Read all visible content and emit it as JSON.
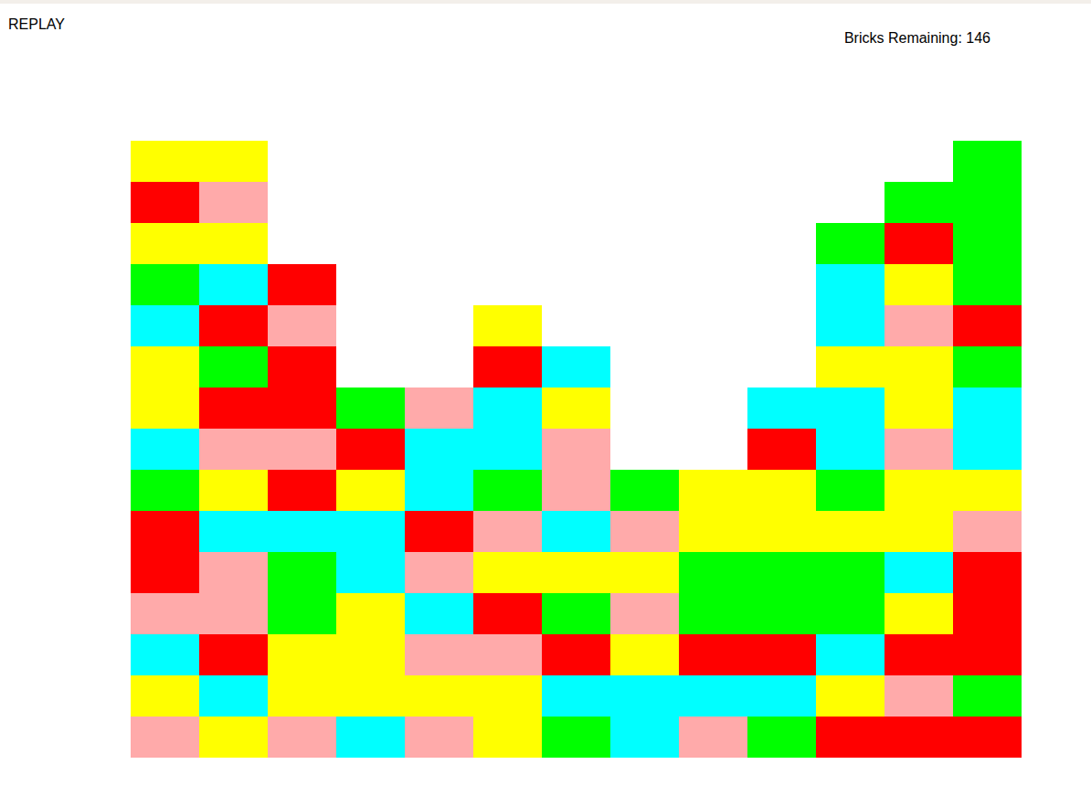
{
  "replay_button": {
    "label": "REPLAY"
  },
  "status": {
    "label": "Bricks Remaining: 146"
  },
  "board": {
    "rows": [
      [
        "#ffff00",
        "#ffff00",
        null,
        null,
        null,
        null,
        null,
        null,
        null,
        null,
        null,
        null,
        "#00ff00"
      ],
      [
        "#ff0000",
        "#ffaaaa",
        null,
        null,
        null,
        null,
        null,
        null,
        null,
        null,
        null,
        "#00ff00",
        "#00ff00"
      ],
      [
        "#ffff00",
        "#ffff00",
        null,
        null,
        null,
        null,
        null,
        null,
        null,
        null,
        "#00ff00",
        "#ff0000",
        "#00ff00"
      ],
      [
        "#00ff00",
        "#00ffff",
        "#ff0000",
        null,
        null,
        null,
        null,
        null,
        null,
        null,
        "#00ffff",
        "#ffff00",
        "#00ff00"
      ],
      [
        "#00ffff",
        "#ff0000",
        "#ffaaaa",
        null,
        null,
        "#ffff00",
        null,
        null,
        null,
        null,
        "#00ffff",
        "#ffaaaa",
        "#ff0000"
      ],
      [
        "#ffff00",
        "#00ff00",
        "#ff0000",
        null,
        null,
        "#ff0000",
        "#00ffff",
        null,
        null,
        null,
        "#ffff00",
        "#ffff00",
        "#00ff00"
      ],
      [
        "#ffff00",
        "#ff0000",
        "#ff0000",
        "#00ff00",
        "#ffaaaa",
        "#00ffff",
        "#ffff00",
        null,
        null,
        "#00ffff",
        "#00ffff",
        "#ffff00",
        "#00ffff"
      ],
      [
        "#00ffff",
        "#ffaaaa",
        "#ffaaaa",
        "#ff0000",
        "#00ffff",
        "#00ffff",
        "#ffaaaa",
        null,
        null,
        "#ff0000",
        "#00ffff",
        "#ffaaaa",
        "#00ffff"
      ],
      [
        "#00ff00",
        "#ffff00",
        "#ff0000",
        "#ffff00",
        "#00ffff",
        "#00ff00",
        "#ffaaaa",
        "#00ff00",
        "#ffff00",
        "#ffff00",
        "#00ff00",
        "#ffff00",
        "#ffff00"
      ],
      [
        "#ff0000",
        "#00ffff",
        "#00ffff",
        "#00ffff",
        "#ff0000",
        "#ffaaaa",
        "#00ffff",
        "#ffaaaa",
        "#ffff00",
        "#ffff00",
        "#ffff00",
        "#ffff00",
        "#ffaaaa"
      ],
      [
        "#ff0000",
        "#ffaaaa",
        "#00ff00",
        "#00ffff",
        "#ffaaaa",
        "#ffff00",
        "#ffff00",
        "#ffff00",
        "#00ff00",
        "#00ff00",
        "#00ff00",
        "#00ffff",
        "#ff0000"
      ],
      [
        "#ffaaaa",
        "#ffaaaa",
        "#00ff00",
        "#ffff00",
        "#00ffff",
        "#ff0000",
        "#00ff00",
        "#ffaaaa",
        "#00ff00",
        "#00ff00",
        "#00ff00",
        "#ffff00",
        "#ff0000"
      ],
      [
        "#00ffff",
        "#ff0000",
        "#ffff00",
        "#ffff00",
        "#ffaaaa",
        "#ffaaaa",
        "#ff0000",
        "#ffff00",
        "#ff0000",
        "#ff0000",
        "#00ffff",
        "#ff0000",
        "#ff0000"
      ],
      [
        "#ffff00",
        "#00ffff",
        "#ffff00",
        "#ffff00",
        "#ffff00",
        "#ffff00",
        "#00ffff",
        "#00ffff",
        "#00ffff",
        "#00ffff",
        "#ffff00",
        "#ffaaaa",
        "#00ff00"
      ],
      [
        "#ffaaaa",
        "#ffff00",
        "#ffaaaa",
        "#00ffff",
        "#ffaaaa",
        "#ffff00",
        "#00ff00",
        "#00ffff",
        "#ffaaaa",
        "#00ff00",
        "#ff0000",
        "#ff0000",
        "#ff0000"
      ]
    ]
  }
}
